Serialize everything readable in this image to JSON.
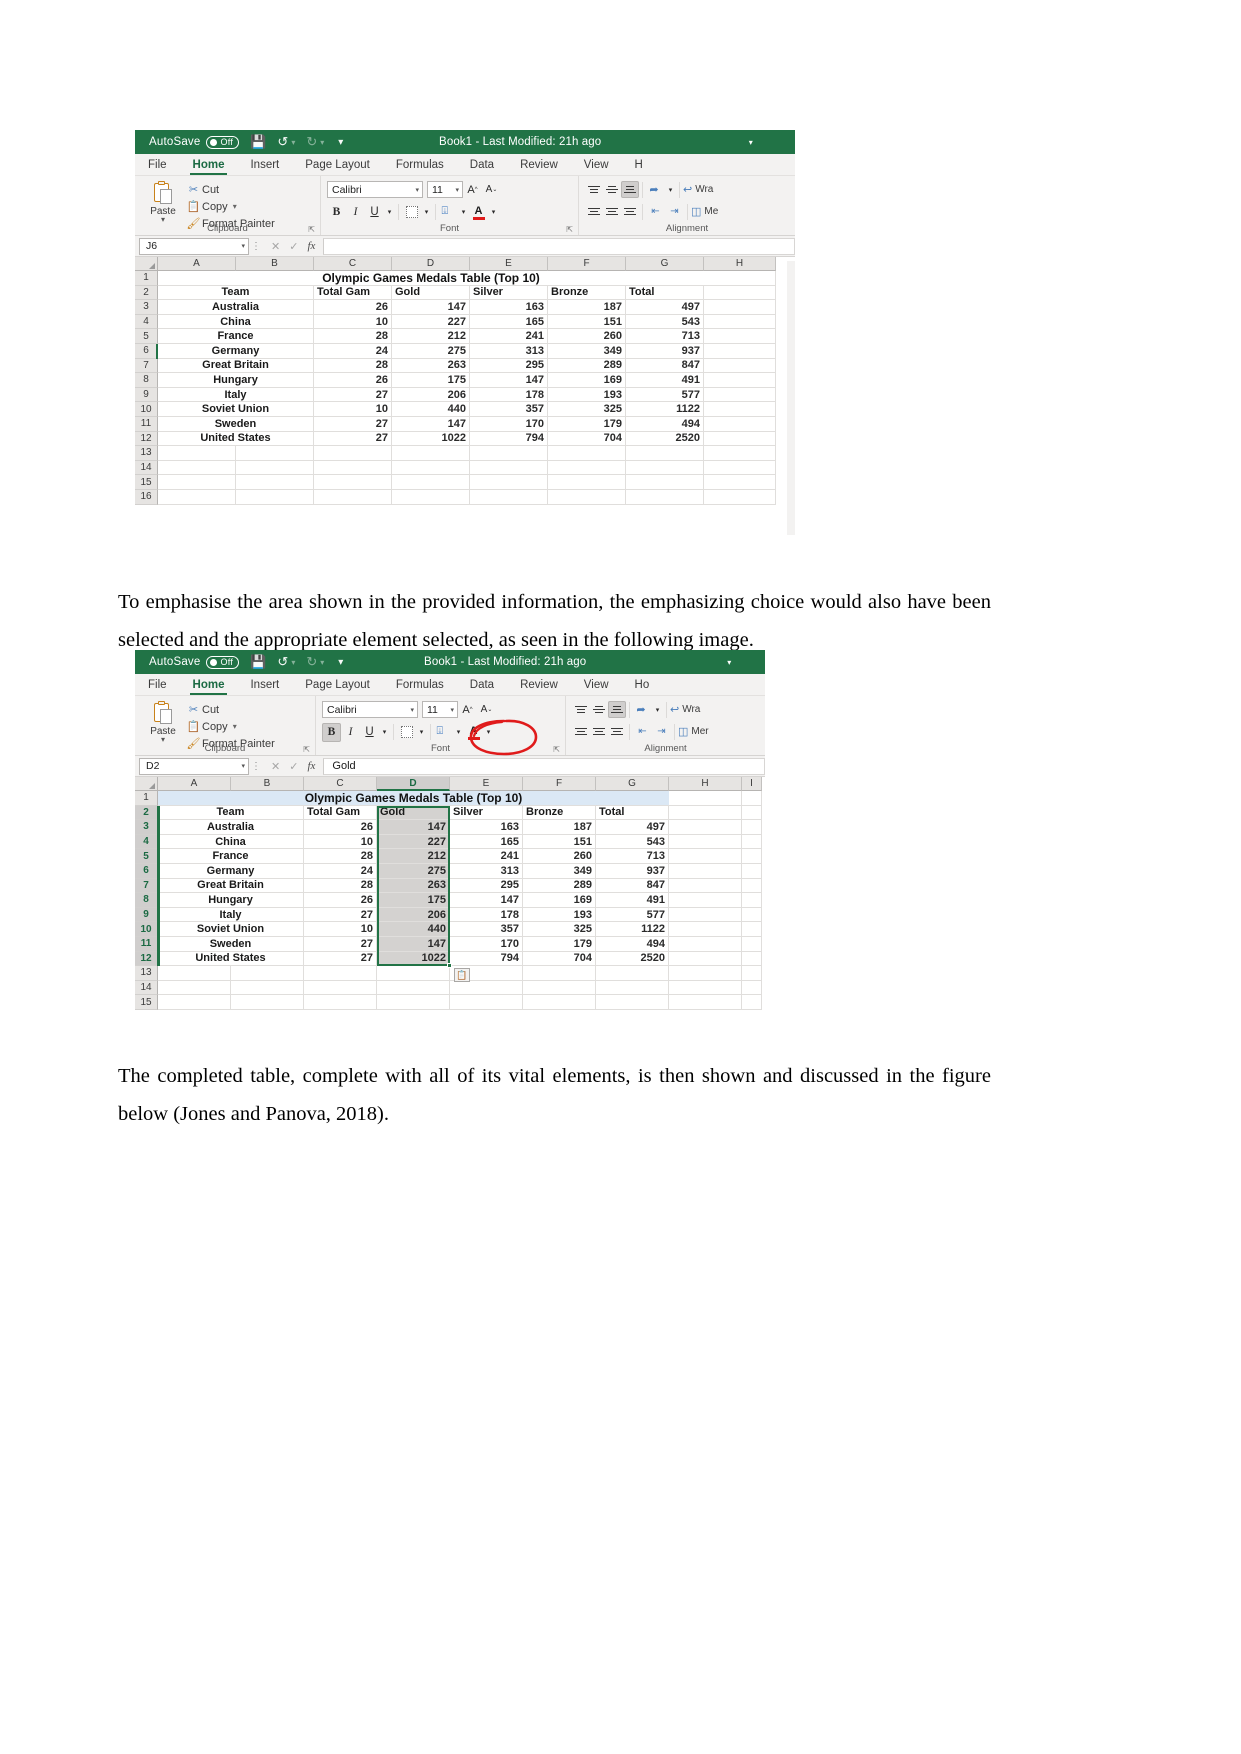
{
  "document": {
    "paragraph_1": "To emphasise the area shown in the provided information, the emphasizing choice would also have been selected and the appropriate element selected, as seen in the following image.",
    "paragraph_2": "The completed table, complete with all of its vital elements, is then shown and discussed in the figure below (Jones and Panova, 2018)."
  },
  "colors": {
    "excel_green": "#217346",
    "annotation_red": "#e01b1b",
    "selection_grey": "#d4d2d0",
    "header_grey": "#e6e4e2"
  },
  "screenshot_1": {
    "titlebar": {
      "autosave_label": "AutoSave",
      "autosave_state": "Off",
      "save_icon": "save-icon",
      "undo_icon": "undo-icon",
      "redo_icon": "redo-icon",
      "customize_icon": "customize-quick-access-icon",
      "document_title": "Book1  -  Last Modified: 21h ago",
      "title_caret": "▾"
    },
    "tabs": [
      {
        "label": "File",
        "active": false
      },
      {
        "label": "Home",
        "active": true
      },
      {
        "label": "Insert",
        "active": false
      },
      {
        "label": "Page Layout",
        "active": false
      },
      {
        "label": "Formulas",
        "active": false
      },
      {
        "label": "Data",
        "active": false
      },
      {
        "label": "Review",
        "active": false
      },
      {
        "label": "View",
        "active": false
      },
      {
        "label": "H",
        "active": false
      }
    ],
    "ribbon": {
      "clipboard": {
        "group_label": "Clipboard",
        "paste_label": "Paste",
        "cut_label": "Cut",
        "copy_label": "Copy",
        "format_painter_label": "Format Painter"
      },
      "font": {
        "group_label": "Font",
        "font_name": "Calibri",
        "font_size": "11",
        "grow_font": "A",
        "shrink_font": "A",
        "bold": "B",
        "italic": "I",
        "underline": "U",
        "borders_icon": "borders-icon",
        "fill_color_icon": "fill-color-icon",
        "font_color_letter": "A"
      },
      "alignment": {
        "group_label": "Alignment",
        "orientation_icon": "orientation-icon",
        "wrap_text_label": "Wra",
        "merge_label": "Me"
      }
    },
    "formula_bar": {
      "name_box": "J6",
      "cancel_icon": "cancel-icon",
      "enter_icon": "enter-icon",
      "function_icon": "fx",
      "formula_value": ""
    },
    "grid": {
      "columns": [
        "A",
        "B",
        "C",
        "D",
        "E",
        "F",
        "G",
        "H"
      ],
      "row_numbers": [
        "1",
        "2",
        "3",
        "4",
        "5",
        "6",
        "7",
        "8",
        "9",
        "10",
        "11",
        "12",
        "13",
        "14",
        "15",
        "16"
      ],
      "title_row": "Olympic Games Medals Table (Top 10)",
      "headers": [
        "Team",
        "Total Gam",
        "Gold",
        "Silver",
        "Bronze",
        "Total"
      ],
      "rows": [
        {
          "team": "Australia",
          "games": "26",
          "gold": "147",
          "silver": "163",
          "bronze": "187",
          "total": "497"
        },
        {
          "team": "China",
          "games": "10",
          "gold": "227",
          "silver": "165",
          "bronze": "151",
          "total": "543"
        },
        {
          "team": "France",
          "games": "28",
          "gold": "212",
          "silver": "241",
          "bronze": "260",
          "total": "713"
        },
        {
          "team": "Germany",
          "games": "24",
          "gold": "275",
          "silver": "313",
          "bronze": "349",
          "total": "937"
        },
        {
          "team": "Great Britain",
          "games": "28",
          "gold": "263",
          "silver": "295",
          "bronze": "289",
          "total": "847"
        },
        {
          "team": "Hungary",
          "games": "26",
          "gold": "175",
          "silver": "147",
          "bronze": "169",
          "total": "491"
        },
        {
          "team": "Italy",
          "games": "27",
          "gold": "206",
          "silver": "178",
          "bronze": "193",
          "total": "577"
        },
        {
          "team": "Soviet Union",
          "games": "10",
          "gold": "440",
          "silver": "357",
          "bronze": "325",
          "total": "1122"
        },
        {
          "team": "Sweden",
          "games": "27",
          "gold": "147",
          "silver": "170",
          "bronze": "179",
          "total": "494"
        },
        {
          "team": "United States",
          "games": "27",
          "gold": "1022",
          "silver": "794",
          "bronze": "704",
          "total": "2520"
        }
      ],
      "active_cell_row_marker": "6"
    }
  },
  "screenshot_2": {
    "titlebar": {
      "autosave_label": "AutoSave",
      "autosave_state": "Off",
      "document_title": "Book1  -  Last Modified: 21h ago",
      "title_caret": "▾"
    },
    "tabs": [
      {
        "label": "File",
        "active": false
      },
      {
        "label": "Home",
        "active": true
      },
      {
        "label": "Insert",
        "active": false
      },
      {
        "label": "Page Layout",
        "active": false
      },
      {
        "label": "Formulas",
        "active": false
      },
      {
        "label": "Data",
        "active": false
      },
      {
        "label": "Review",
        "active": false
      },
      {
        "label": "View",
        "active": false
      },
      {
        "label": "Ho",
        "active": false
      }
    ],
    "ribbon": {
      "clipboard": {
        "group_label": "Clipboard",
        "paste_label": "Paste",
        "cut_label": "Cut",
        "copy_label": "Copy",
        "format_painter_label": "Format Painter"
      },
      "font": {
        "group_label": "Font",
        "font_name": "Calibri",
        "font_size": "11",
        "bold": "B",
        "italic": "I",
        "underline": "U",
        "font_color_letter": "A",
        "highlighted_control": "fill-color-icon"
      },
      "alignment": {
        "group_label": "Alignment",
        "wrap_text_label": "Wra",
        "merge_label": "Mer"
      }
    },
    "formula_bar": {
      "name_box": "D2",
      "function_icon": "fx",
      "formula_value": "Gold"
    },
    "grid": {
      "columns": [
        "A",
        "B",
        "C",
        "D",
        "E",
        "F",
        "G",
        "H",
        "I"
      ],
      "selected_column": "D",
      "row_numbers": [
        "1",
        "2",
        "3",
        "4",
        "5",
        "6",
        "7",
        "8",
        "9",
        "10",
        "11",
        "12",
        "13",
        "14",
        "15"
      ],
      "title_row": "Olympic Games Medals Table (Top 10)",
      "headers": [
        "Team",
        "Total Gam",
        "Gold",
        "Silver",
        "Bronze",
        "Total"
      ],
      "rows": [
        {
          "team": "Australia",
          "games": "26",
          "gold": "147",
          "silver": "163",
          "bronze": "187",
          "total": "497"
        },
        {
          "team": "China",
          "games": "10",
          "gold": "227",
          "silver": "165",
          "bronze": "151",
          "total": "543"
        },
        {
          "team": "France",
          "games": "28",
          "gold": "212",
          "silver": "241",
          "bronze": "260",
          "total": "713"
        },
        {
          "team": "Germany",
          "games": "24",
          "gold": "275",
          "silver": "313",
          "bronze": "349",
          "total": "937"
        },
        {
          "team": "Great Britain",
          "games": "28",
          "gold": "263",
          "silver": "295",
          "bronze": "289",
          "total": "847"
        },
        {
          "team": "Hungary",
          "games": "26",
          "gold": "175",
          "silver": "147",
          "bronze": "169",
          "total": "491"
        },
        {
          "team": "Italy",
          "games": "27",
          "gold": "206",
          "silver": "178",
          "bronze": "193",
          "total": "577"
        },
        {
          "team": "Soviet Union",
          "games": "10",
          "gold": "440",
          "silver": "357",
          "bronze": "325",
          "total": "1122"
        },
        {
          "team": "Sweden",
          "games": "27",
          "gold": "147",
          "silver": "170",
          "bronze": "179",
          "total": "494"
        },
        {
          "team": "United States",
          "games": "27",
          "gold": "1022",
          "silver": "794",
          "bronze": "704",
          "total": "2520"
        }
      ],
      "paste_options_icon": "paste-options-icon"
    },
    "annotation": {
      "type": "hand-drawn-red-ellipse",
      "target": "fill-color-icon"
    }
  }
}
